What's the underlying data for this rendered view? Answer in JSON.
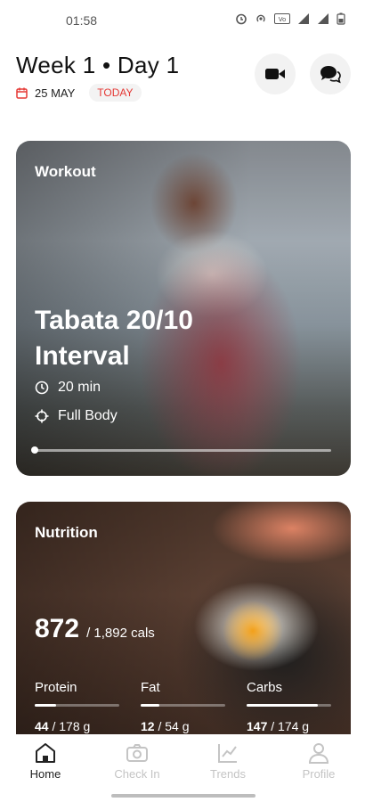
{
  "status_bar": {
    "time": "01:58",
    "icons": [
      "alarm-icon",
      "hotspot-icon",
      "volte-icon",
      "wifi-icon",
      "signal-icon",
      "battery-icon"
    ]
  },
  "header": {
    "title": "Week 1 • Day 1",
    "date": "25 MAY",
    "today_label": "TODAY",
    "video_icon": "video-camera-icon",
    "chat_icon": "chat-bubbles-icon"
  },
  "workout": {
    "label": "Workout",
    "title": "Tabata 20/10 Interval",
    "duration": "20 min",
    "target": "Full Body",
    "progress": 0.0
  },
  "nutrition": {
    "label": "Nutrition",
    "calories": "872",
    "calories_target": "/ 1,892 cals",
    "macros": [
      {
        "label": "Protein",
        "value": "44",
        "target": "/ 178 g",
        "progress": 0.25
      },
      {
        "label": "Fat",
        "value": "12",
        "target": "/ 54 g",
        "progress": 0.22
      },
      {
        "label": "Carbs",
        "value": "147",
        "target": "/ 174 g",
        "progress": 0.84
      }
    ]
  },
  "nav": {
    "items": [
      {
        "label": "Home",
        "icon": "home-icon",
        "active": true
      },
      {
        "label": "Check In",
        "icon": "camera-icon",
        "active": false
      },
      {
        "label": "Trends",
        "icon": "trends-chart-icon",
        "active": false
      },
      {
        "label": "Profile",
        "icon": "profile-icon",
        "active": false
      }
    ]
  },
  "colors": {
    "accent_red": "#e53935",
    "text_dark": "#111111",
    "nav_inactive": "#c4c4c4"
  }
}
